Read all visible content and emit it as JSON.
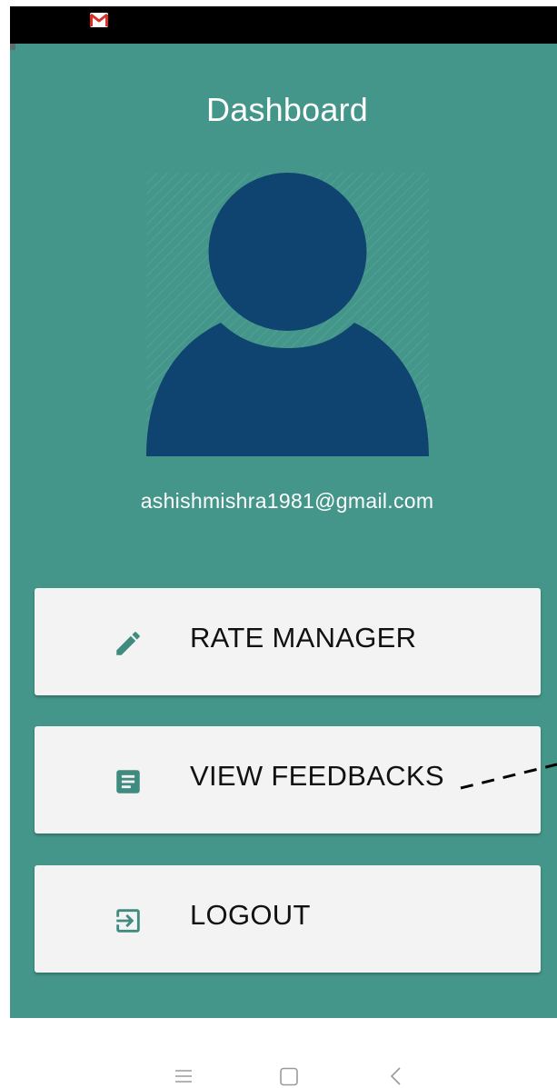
{
  "status_bar": {
    "notification_icon": "gmail-icon"
  },
  "header": {
    "title": "Dashboard"
  },
  "profile": {
    "avatar_icon": "person-icon",
    "email": "ashishmishra1981@gmail.com"
  },
  "menu": [
    {
      "label": "RATE MANAGER",
      "icon": "pencil-icon"
    },
    {
      "label": "VIEW FEEDBACKS",
      "icon": "document-icon"
    },
    {
      "label": "LOGOUT",
      "icon": "logout-icon"
    }
  ],
  "nav": {
    "menu_icon": "menu-icon",
    "home_icon": "home-icon",
    "back_icon": "back-icon"
  },
  "colors": {
    "background": "#45968a",
    "avatar": "#0f4470",
    "card": "#f3f3f3",
    "icon_accent": "#3f8b80"
  }
}
